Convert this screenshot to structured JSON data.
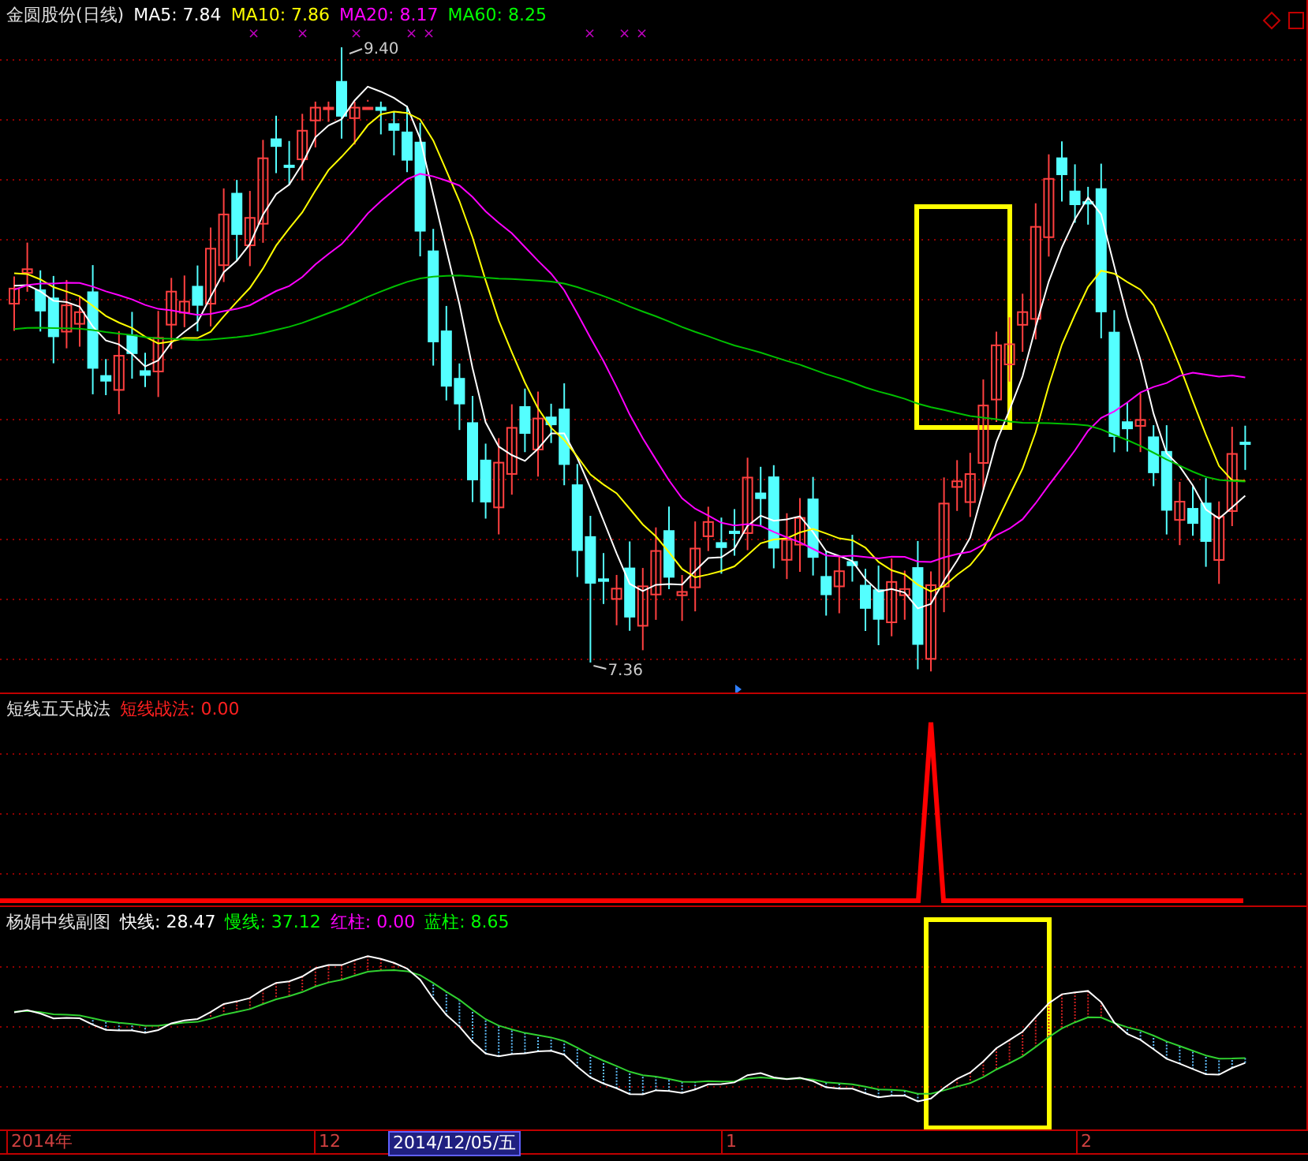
{
  "main_panel": {
    "title": "金圆股份(日线)",
    "indicators": [
      {
        "label": "MA5: 7.84",
        "color": "#ffffff"
      },
      {
        "label": "MA10: 7.86",
        "color": "#ffff00"
      },
      {
        "label": "MA20: 8.17",
        "color": "#ff00ff"
      },
      {
        "label": "MA60: 8.25",
        "color": "#00ff00"
      }
    ],
    "high_label": "9.40",
    "low_label": "7.36",
    "markers": [
      "×",
      "×",
      "×",
      "×",
      "×",
      "×",
      "×",
      "×"
    ]
  },
  "signal_panel": {
    "title": "短线五天战法",
    "indicators": [
      {
        "label": "短线战法: 0.00",
        "color": "#ff2020"
      }
    ]
  },
  "sub_panel": {
    "title": "杨娟中线副图",
    "indicators": [
      {
        "label": "快线: 28.47",
        "color": "#ffffff"
      },
      {
        "label": "慢线: 37.12",
        "color": "#00ff00"
      },
      {
        "label": "红柱: 0.00",
        "color": "#ff00ff"
      },
      {
        "label": "蓝柱: 8.65",
        "color": "#00ff00"
      }
    ]
  },
  "time_axis": [
    {
      "label": "2014年",
      "kind": "tick"
    },
    {
      "label": "12",
      "kind": "tick"
    },
    {
      "label": "2014/12/05/五",
      "kind": "cursor"
    },
    {
      "label": "1",
      "kind": "tick"
    },
    {
      "label": "2",
      "kind": "tick"
    }
  ]
}
